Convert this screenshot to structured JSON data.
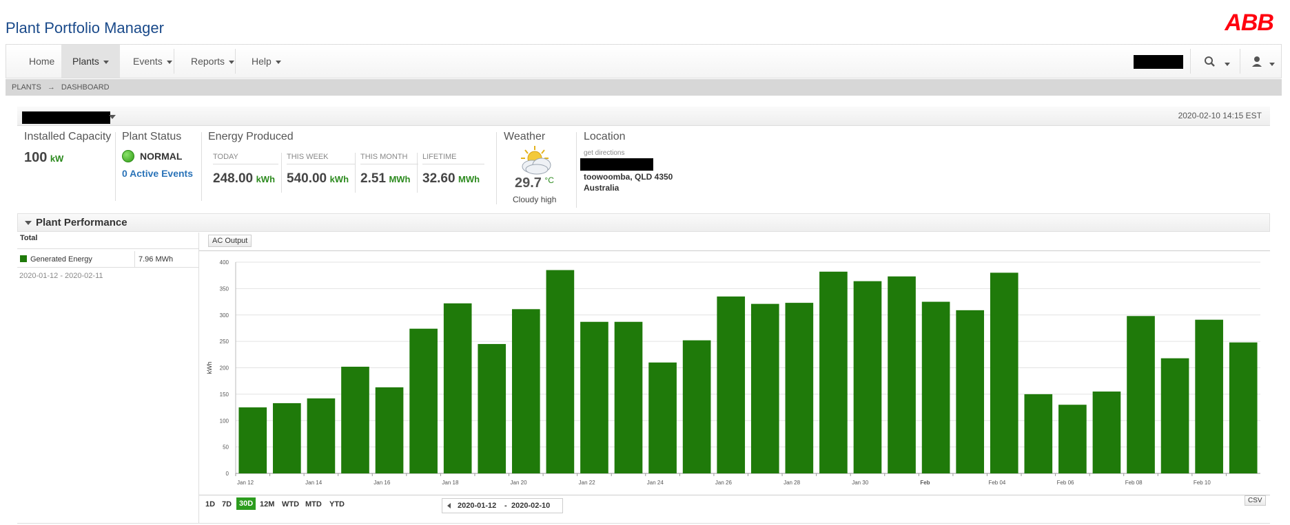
{
  "app": {
    "title": "Plant Portfolio Manager",
    "logo": "ABB"
  },
  "nav": {
    "home": "Home",
    "plants": "Plants",
    "events": "Events",
    "reports": "Reports",
    "help": "Help"
  },
  "breadcrumb": {
    "plants": "PLANTS",
    "arrow": "→",
    "dashboard": "DASHBOARD"
  },
  "header": {
    "timestamp": "2020-02-10 14:15 EST"
  },
  "capacity": {
    "title": "Installed Capacity",
    "value": "100",
    "unit": "kW"
  },
  "status": {
    "title": "Plant Status",
    "value": "NORMAL",
    "events": "0 Active Events",
    "color": "#43b02a"
  },
  "energy": {
    "title": "Energy Produced",
    "today": {
      "label": "TODAY",
      "value": "248.00",
      "unit": "kWh"
    },
    "week": {
      "label": "THIS WEEK",
      "value": "540.00",
      "unit": "kWh"
    },
    "month": {
      "label": "THIS MONTH",
      "value": "2.51",
      "unit": "MWh"
    },
    "lifetime": {
      "label": "LIFETIME",
      "value": "32.60",
      "unit": "MWh"
    }
  },
  "weather": {
    "title": "Weather",
    "temp": "29.7",
    "unit": "°C",
    "desc": "Cloudy high",
    "icon": "cloudy-sun-icon"
  },
  "location": {
    "title": "Location",
    "directions": "get directions",
    "city": "toowoomba, QLD  4350",
    "country": "Australia"
  },
  "performance": {
    "title": "Plant Performance",
    "total_label": "Total",
    "series_label": "Generated Energy",
    "series_value": "7.96 MWh",
    "date_range": "2020-01-12 - 2020-02-11",
    "tab": "AC Output",
    "ranges": [
      "1D",
      "7D",
      "30D",
      "12M",
      "WTD",
      "MTD",
      "YTD"
    ],
    "active_range": "30D",
    "range_start": "2020-01-12",
    "range_sep": "-",
    "range_end": "2020-02-10",
    "csv": "CSV"
  },
  "chart_data": {
    "type": "bar",
    "ylabel": "kWh",
    "ylim": [
      0,
      400
    ],
    "yticks": [
      0,
      50,
      100,
      150,
      200,
      250,
      300,
      350,
      400
    ],
    "color": "#1f7a0a",
    "categories": [
      "2020-01-12",
      "2020-01-13",
      "2020-01-14",
      "2020-01-15",
      "2020-01-16",
      "2020-01-17",
      "2020-01-18",
      "2020-01-19",
      "2020-01-20",
      "2020-01-21",
      "2020-01-22",
      "2020-01-23",
      "2020-01-24",
      "2020-01-25",
      "2020-01-26",
      "2020-01-27",
      "2020-01-28",
      "2020-01-29",
      "2020-01-30",
      "2020-01-31",
      "2020-02-01",
      "2020-02-02",
      "2020-02-03",
      "2020-02-04",
      "2020-02-05",
      "2020-02-06",
      "2020-02-07",
      "2020-02-08",
      "2020-02-09",
      "2020-02-10"
    ],
    "values": [
      125,
      133,
      142,
      202,
      163,
      274,
      322,
      245,
      311,
      385,
      287,
      287,
      210,
      252,
      335,
      321,
      323,
      382,
      364,
      373,
      325,
      309,
      380,
      150,
      130,
      155,
      298,
      218,
      291,
      248
    ],
    "xtick_labels": [
      "Jan 12",
      "",
      "Jan 14",
      "",
      "Jan 16",
      "",
      "Jan 18",
      "",
      "Jan 20",
      "",
      "Jan 22",
      "",
      "Jan 24",
      "",
      "Jan 26",
      "",
      "Jan 28",
      "",
      "Jan 30",
      "",
      "Feb",
      "",
      "Feb 04",
      "",
      "Feb 06",
      "",
      "Feb 08",
      "",
      "Feb 10",
      ""
    ]
  }
}
